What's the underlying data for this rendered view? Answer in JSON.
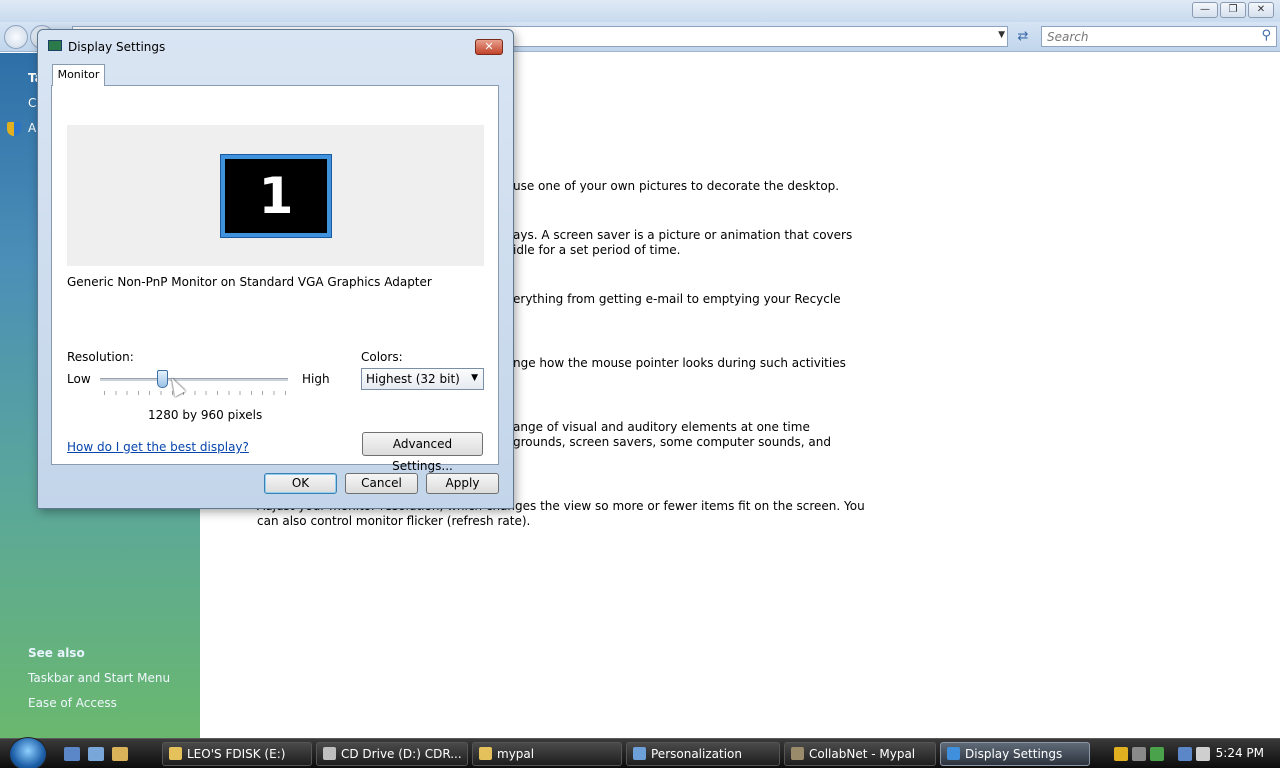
{
  "explorer": {
    "search_placeholder": "Search",
    "left_pane": {
      "frag_1": "Ta",
      "frag_2": "C",
      "frag_3": "A",
      "see_also_heading": "See also",
      "links": [
        "Taskbar and Start Menu",
        "Ease of Access"
      ]
    },
    "content_lines": [
      "use one of your own pictures to decorate the desktop.",
      "ays. A screen saver is a picture or animation that covers",
      "idle for a set period of time.",
      "erything from getting e-mail to emptying your Recycle",
      "nge how the mouse pointer looks during such activities",
      "ange of visual and auditory elements at one time",
      "grounds, screen savers, some computer sounds, and",
      "Adjust your monitor resolution, which changes the view so more or fewer items fit on the screen. You",
      "can also control monitor flicker (refresh rate)."
    ]
  },
  "dialog": {
    "title": "Display Settings",
    "tab_label": "Monitor",
    "monitor_number": "1",
    "monitor_description": "Generic Non-PnP Monitor on Standard VGA Graphics Adapter",
    "resolution_label": "Resolution:",
    "low_label": "Low",
    "high_label": "High",
    "resolution_value": "1280 by 960 pixels",
    "resolution_slider_fraction": 0.33,
    "colors_label": "Colors:",
    "colors_selected": "Highest (32 bit)",
    "help_link": "How do I get the best display?",
    "advanced_button": "Advanced Settings...",
    "ok_button": "OK",
    "cancel_button": "Cancel",
    "apply_button": "Apply"
  },
  "taskbar": {
    "buttons": [
      "LEO'S FDISK (E:)",
      "CD Drive (D:) CDR...",
      "mypal",
      "Personalization",
      "CollabNet - Mypal",
      "Display Settings"
    ],
    "clock": "5:24 PM"
  }
}
